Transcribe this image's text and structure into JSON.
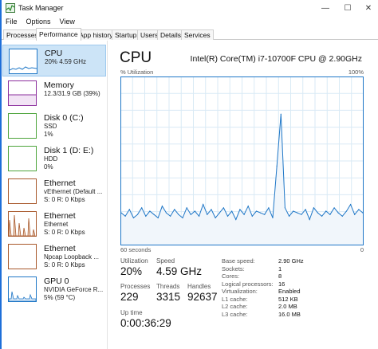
{
  "window": {
    "title": "Task Manager",
    "minimize": "—",
    "maximize": "☐",
    "close": "✕"
  },
  "menu": [
    "File",
    "Options",
    "View"
  ],
  "tabs": [
    {
      "label": "Processes",
      "active": false
    },
    {
      "label": "Performance",
      "active": true
    },
    {
      "label": "App history",
      "active": false
    },
    {
      "label": "Startup",
      "active": false
    },
    {
      "label": "Users",
      "active": false
    },
    {
      "label": "Details",
      "active": false
    },
    {
      "label": "Services",
      "active": false
    }
  ],
  "colors": {
    "cpu": "#1f77c7",
    "cpu_fill": "#f1f6fb",
    "memory": "#8b2d9c",
    "disk": "#4da43b",
    "ethernet": "#a8582b",
    "gpu": "#1f77c7",
    "selected_bg": "#cce4f7",
    "grid": "#d9eaf5"
  },
  "sidebar": [
    {
      "title": "CPU",
      "lines": [
        "20%  4.59 GHz"
      ],
      "color": "cpu",
      "selected": true
    },
    {
      "title": "Memory",
      "lines": [
        "12.3/31.9 GB (39%)"
      ],
      "color": "memory",
      "selected": false
    },
    {
      "title": "Disk 0 (C:)",
      "lines": [
        "SSD",
        "1%"
      ],
      "color": "disk",
      "selected": false
    },
    {
      "title": "Disk 1 (D: E:)",
      "lines": [
        "HDD",
        "0%"
      ],
      "color": "disk",
      "selected": false
    },
    {
      "title": "Ethernet",
      "lines": [
        "vEthernet (Default ...",
        "S: 0  R: 0 Kbps"
      ],
      "color": "ethernet",
      "selected": false
    },
    {
      "title": "Ethernet",
      "lines": [
        "Ethernet",
        "S: 0  R: 0 Kbps"
      ],
      "color": "ethernet",
      "selected": false
    },
    {
      "title": "Ethernet",
      "lines": [
        "Npcap Loopback ...",
        "S: 0  R: 0 Kbps"
      ],
      "color": "ethernet",
      "selected": false
    },
    {
      "title": "GPU 0",
      "lines": [
        "NVIDIA GeForce R...",
        "5%  (59 °C)"
      ],
      "color": "gpu",
      "selected": false
    }
  ],
  "main": {
    "title": "CPU",
    "cpu_name": "Intel(R) Core(TM) i7-10700F CPU @ 2.90GHz",
    "graph_label": "% Utilization",
    "graph_max": "100%",
    "axis_left": "60 seconds",
    "axis_right": "0",
    "stats": {
      "utilization_label": "Utilization",
      "utilization": "20%",
      "speed_label": "Speed",
      "speed": "4.59 GHz",
      "processes_label": "Processes",
      "processes": "229",
      "threads_label": "Threads",
      "threads": "3315",
      "handles_label": "Handles",
      "handles": "92637",
      "uptime_label": "Up time",
      "uptime": "0:00:36:29"
    },
    "specs": [
      {
        "key": "Base speed:",
        "value": "2.90 GHz"
      },
      {
        "key": "Sockets:",
        "value": "1"
      },
      {
        "key": "Cores:",
        "value": "8"
      },
      {
        "key": "Logical processors:",
        "value": "16"
      },
      {
        "key": "Virtualization:",
        "value": "Enabled"
      },
      {
        "key": "L1 cache:",
        "value": "512 KB"
      },
      {
        "key": "L2 cache:",
        "value": "2.0 MB"
      },
      {
        "key": "L3 cache:",
        "value": "16.0 MB"
      }
    ]
  },
  "chart_data": {
    "type": "area",
    "title": "% Utilization",
    "ylim": [
      0,
      100
    ],
    "x_range_seconds": [
      60,
      0
    ],
    "grid": true,
    "values": [
      19,
      17,
      21,
      16,
      18,
      22,
      17,
      20,
      18,
      16,
      23,
      19,
      17,
      21,
      18,
      16,
      22,
      18,
      20,
      17,
      24,
      18,
      21,
      16,
      19,
      22,
      17,
      20,
      15,
      21,
      18,
      23,
      17,
      20,
      19,
      18,
      22,
      16,
      47,
      78,
      22,
      17,
      20,
      19,
      18,
      21,
      15,
      22,
      19,
      17,
      20,
      18,
      22,
      19,
      17,
      20,
      24,
      18,
      21,
      19
    ]
  }
}
